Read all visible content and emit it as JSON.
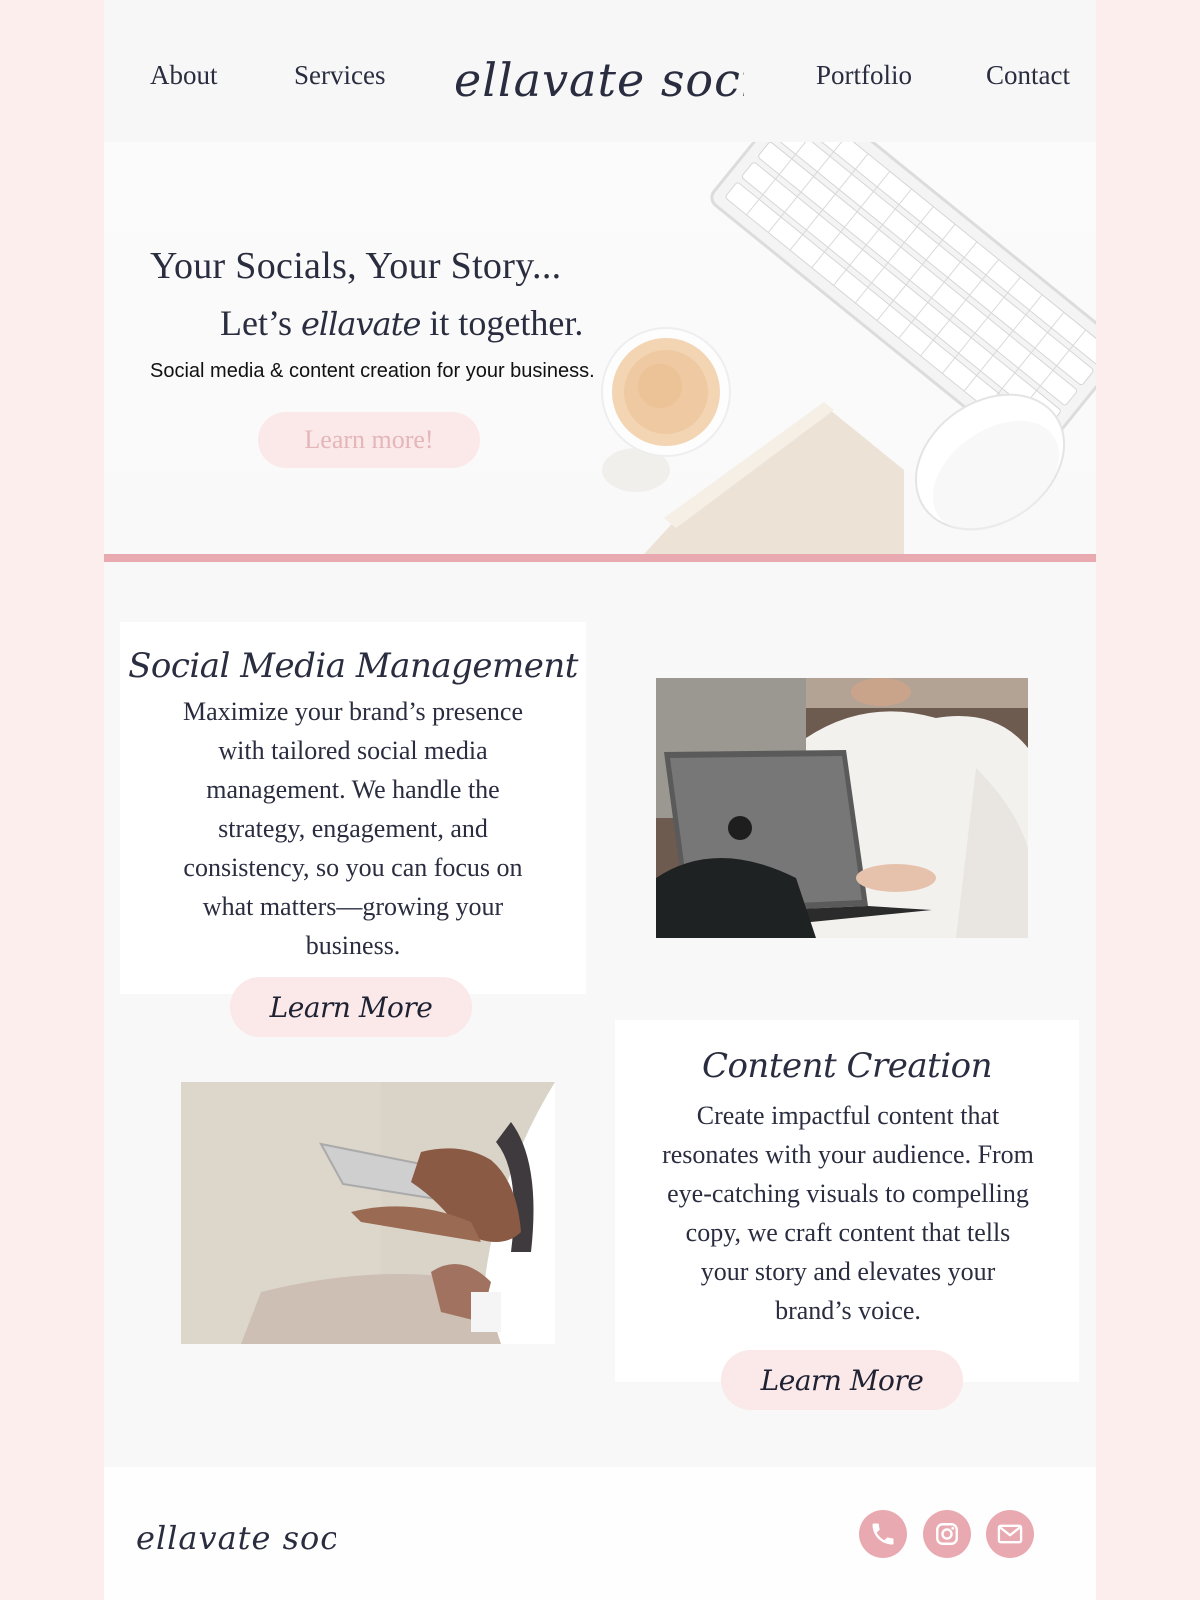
{
  "nav": {
    "items": [
      "About",
      "Services",
      "Portfolio",
      "Contact"
    ],
    "logo": "ellavate socials"
  },
  "hero": {
    "title": "Your Socials, Your Story...",
    "subtitle_before": "Let’s",
    "subtitle_script": "ellavate",
    "subtitle_after": "it together.",
    "description": "Social media & content creation for your business.",
    "button": "Learn more!"
  },
  "services": [
    {
      "title": "Social Media Management",
      "body": "Maximize your brand’s presence with tailored social media management. We handle the strategy, engagement, and consistency, so you can focus on what matters—growing your business.",
      "button": "Learn More"
    },
    {
      "title": "Content Creation",
      "body": "Create impactful content that resonates with your audience. From eye-catching visuals to compelling copy, we craft content that tells your story and elevates your brand’s voice.",
      "button": "Learn More"
    }
  ],
  "footer": {
    "logo": "ellavate socials",
    "icons": [
      "phone-icon",
      "instagram-icon",
      "mail-icon"
    ]
  },
  "colors": {
    "accent_pink": "#e9a9b1",
    "button_pink": "#fbe8e8",
    "text_navy": "#2a2d3f",
    "page_bg": "#fdeeee"
  }
}
